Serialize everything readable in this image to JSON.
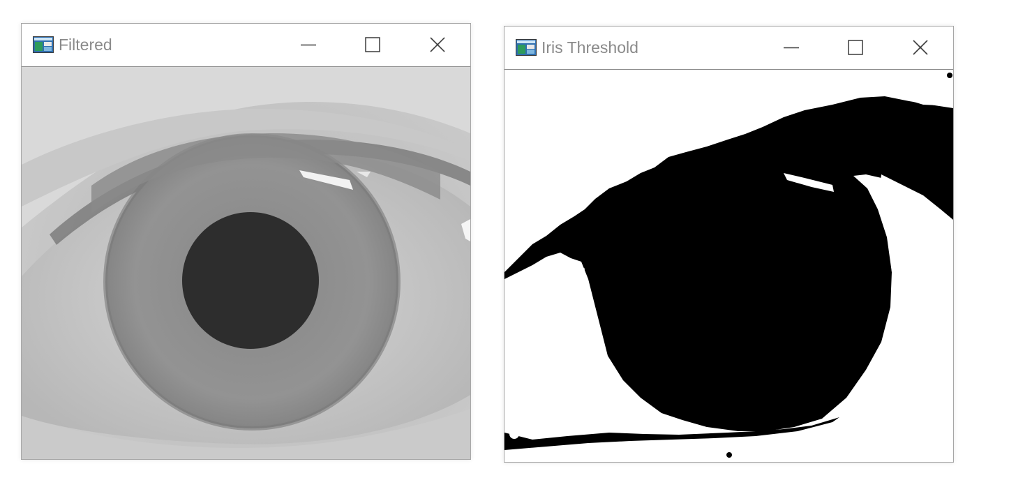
{
  "windows": [
    {
      "title": "Filtered",
      "icon": "opencv-window-icon",
      "controls": [
        "minimize",
        "maximize",
        "close"
      ],
      "content": "grayscale-eye-image"
    },
    {
      "title": "Iris Threshold",
      "icon": "opencv-window-icon",
      "controls": [
        "minimize",
        "maximize",
        "close"
      ],
      "content": "binary-threshold-eye-image"
    }
  ],
  "colors": {
    "title_text": "#8a8a8a",
    "window_border": "#a6a6a6",
    "threshold_foreground": "#000000",
    "threshold_background": "#ffffff"
  }
}
